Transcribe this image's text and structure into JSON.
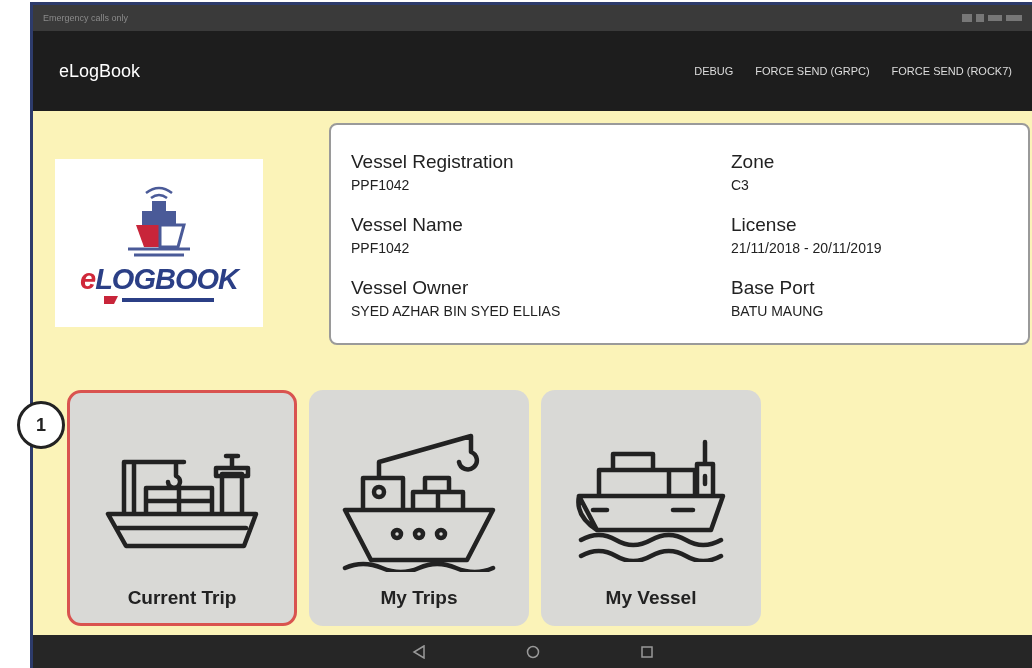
{
  "status_bar": {
    "text": "Emergency calls only"
  },
  "app_bar": {
    "title": "eLogBook",
    "actions": [
      "DEBUG",
      "FORCE SEND (GRPC)",
      "FORCE SEND (ROCK7)"
    ]
  },
  "logo": {
    "prefix": "e",
    "name": "LOGBOOK"
  },
  "vessel_info": [
    {
      "label": "Vessel Registration",
      "value": "PPF1042"
    },
    {
      "label": "Zone",
      "value": "C3"
    },
    {
      "label": "Vessel Name",
      "value": "PPF1042"
    },
    {
      "label": "License",
      "value": "21/11/2018 - 20/11/2019"
    },
    {
      "label": "Vessel Owner",
      "value": "SYED AZHAR BIN SYED ELLIAS"
    },
    {
      "label": "Base Port",
      "value": "BATU MAUNG"
    }
  ],
  "tiles": [
    {
      "kind": "current",
      "label": "Current Trip",
      "selected": true
    },
    {
      "kind": "trips",
      "label": "My Trips",
      "selected": false
    },
    {
      "kind": "vessel",
      "label": "My Vessel",
      "selected": false
    }
  ],
  "callout": "1"
}
